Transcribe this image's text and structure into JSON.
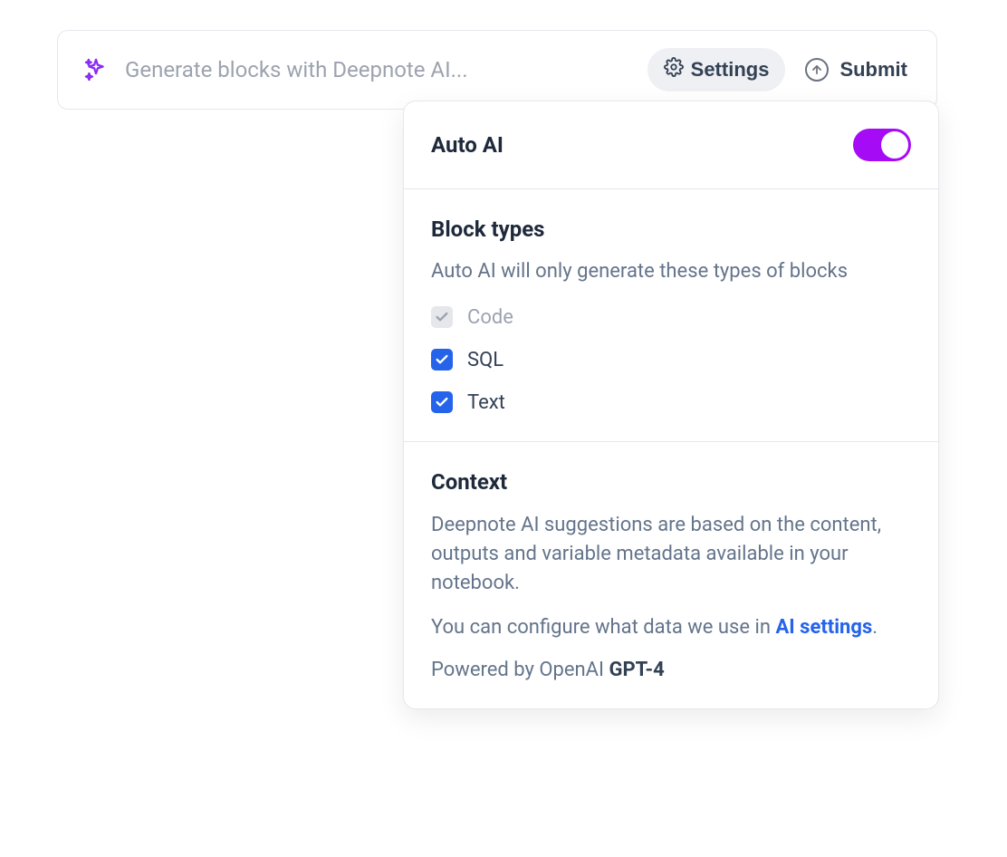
{
  "input": {
    "placeholder": "Generate blocks with Deepnote AI...",
    "settings_label": "Settings",
    "submit_label": "Submit"
  },
  "panel": {
    "auto_ai": {
      "title": "Auto AI",
      "enabled": true
    },
    "block_types": {
      "title": "Block types",
      "description": "Auto AI will only generate these types of blocks",
      "items": [
        {
          "label": "Code",
          "checked": true,
          "disabled": true
        },
        {
          "label": "SQL",
          "checked": true,
          "disabled": false
        },
        {
          "label": "Text",
          "checked": true,
          "disabled": false
        }
      ]
    },
    "context": {
      "title": "Context",
      "paragraph1": "Deepnote AI suggestions are based on the content, outputs and variable metadata available in your notebook.",
      "paragraph2_prefix": "You can configure what data we use in ",
      "paragraph2_link": "AI settings",
      "paragraph2_suffix": ".",
      "powered_prefix": "Powered by OpenAI ",
      "powered_model": "GPT-4"
    }
  }
}
